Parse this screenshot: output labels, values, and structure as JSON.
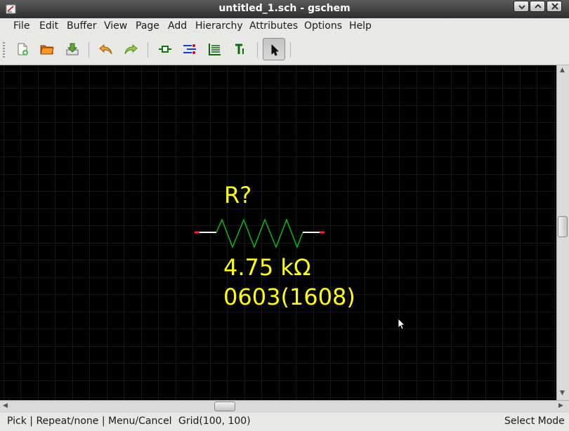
{
  "window": {
    "title": "untitled_1.sch - gschem",
    "controls": [
      "minimize-icon",
      "maximize-icon",
      "close-icon"
    ]
  },
  "menubar": {
    "items": [
      {
        "label": "File"
      },
      {
        "label": "Edit"
      },
      {
        "label": "Buffer"
      },
      {
        "label": "View"
      },
      {
        "label": "Page"
      },
      {
        "label": "Add"
      },
      {
        "label": "Hierarchy"
      },
      {
        "label": "Attributes"
      },
      {
        "label": "Options"
      },
      {
        "label": "Help"
      }
    ]
  },
  "toolbar": {
    "buttons": [
      {
        "icon": "new-file-icon"
      },
      {
        "icon": "open-folder-icon"
      },
      {
        "icon": "save-icon"
      },
      {
        "icon": "undo-icon"
      },
      {
        "icon": "redo-icon"
      },
      {
        "icon": "add-component-icon"
      },
      {
        "icon": "add-net-icon"
      },
      {
        "icon": "add-bus-icon"
      },
      {
        "icon": "add-text-icon"
      },
      {
        "icon": "select-arrow-icon",
        "active": true
      }
    ]
  },
  "schematic": {
    "background": "#000000",
    "grid_color": "#2e2e2e",
    "component": {
      "refdes": "R?",
      "value": "4.75 kΩ",
      "footprint": "0603(1608)",
      "attribute_color": "#ffff00",
      "body_color": "#00c000",
      "pin_color": "#ffffff",
      "pin_end_color": "#ff0000"
    }
  },
  "statusbar": {
    "mouse_hint": "Pick | Repeat/none | Menu/Cancel",
    "grid": "Grid(100, 100)",
    "mode": "Select Mode"
  }
}
